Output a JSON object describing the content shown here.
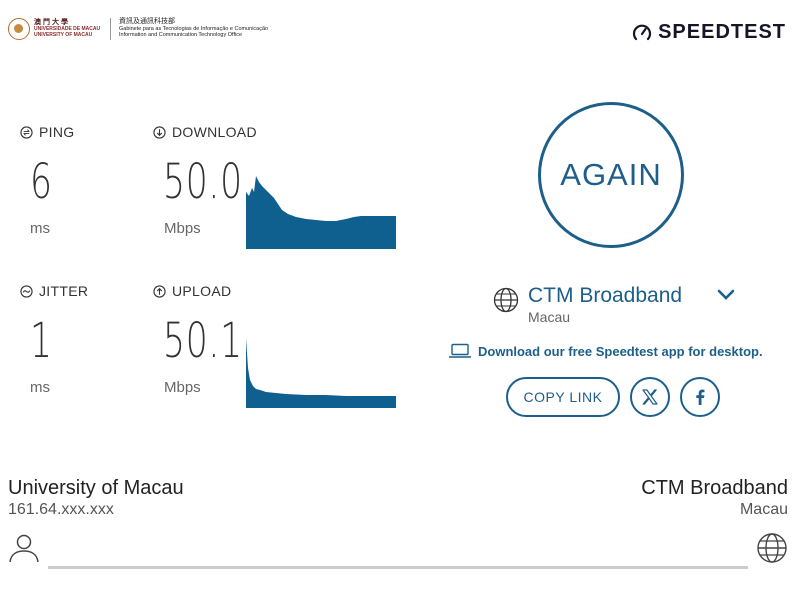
{
  "header": {
    "university_cn": "澳門大學",
    "university_pt": "UNIVERSIDADE DE MACAU",
    "university_en": "UNIVERSITY OF MACAU",
    "office_cn": "資訊及通訊科技部",
    "office_pt": "Gabinete para as Tecnologias de Informação e Comunicação",
    "office_en": "Information and Communication Technology Office",
    "brand": "SPEEDTEST"
  },
  "metrics": {
    "ping": {
      "label": "PING",
      "value": "6",
      "unit": "ms"
    },
    "download": {
      "label": "DOWNLOAD",
      "value": "50.0",
      "unit": "Mbps"
    },
    "jitter": {
      "label": "JITTER",
      "value": "1",
      "unit": "ms"
    },
    "upload": {
      "label": "UPLOAD",
      "value": "50.1",
      "unit": "Mbps"
    }
  },
  "colors": {
    "accent": "#1d5f8a",
    "graph": "#0f5f8f",
    "bar": "#cccccc"
  },
  "actions": {
    "again_label": "AGAIN",
    "download_app": "Download our free Speedtest app for desktop.",
    "copy_link": "COPY LINK"
  },
  "server": {
    "isp": "CTM Broadband",
    "location": "Macau"
  },
  "client": {
    "name": "University of Macau",
    "ip": "161.64.xxx.xxx"
  },
  "host": {
    "name": "CTM Broadband",
    "location": "Macau"
  },
  "icons": [
    "ping-icon",
    "download-icon",
    "jitter-icon",
    "upload-icon",
    "globe-icon",
    "chevron-down-icon",
    "laptop-icon",
    "x-icon",
    "facebook-icon",
    "user-icon",
    "speedtest-gauge-icon"
  ]
}
